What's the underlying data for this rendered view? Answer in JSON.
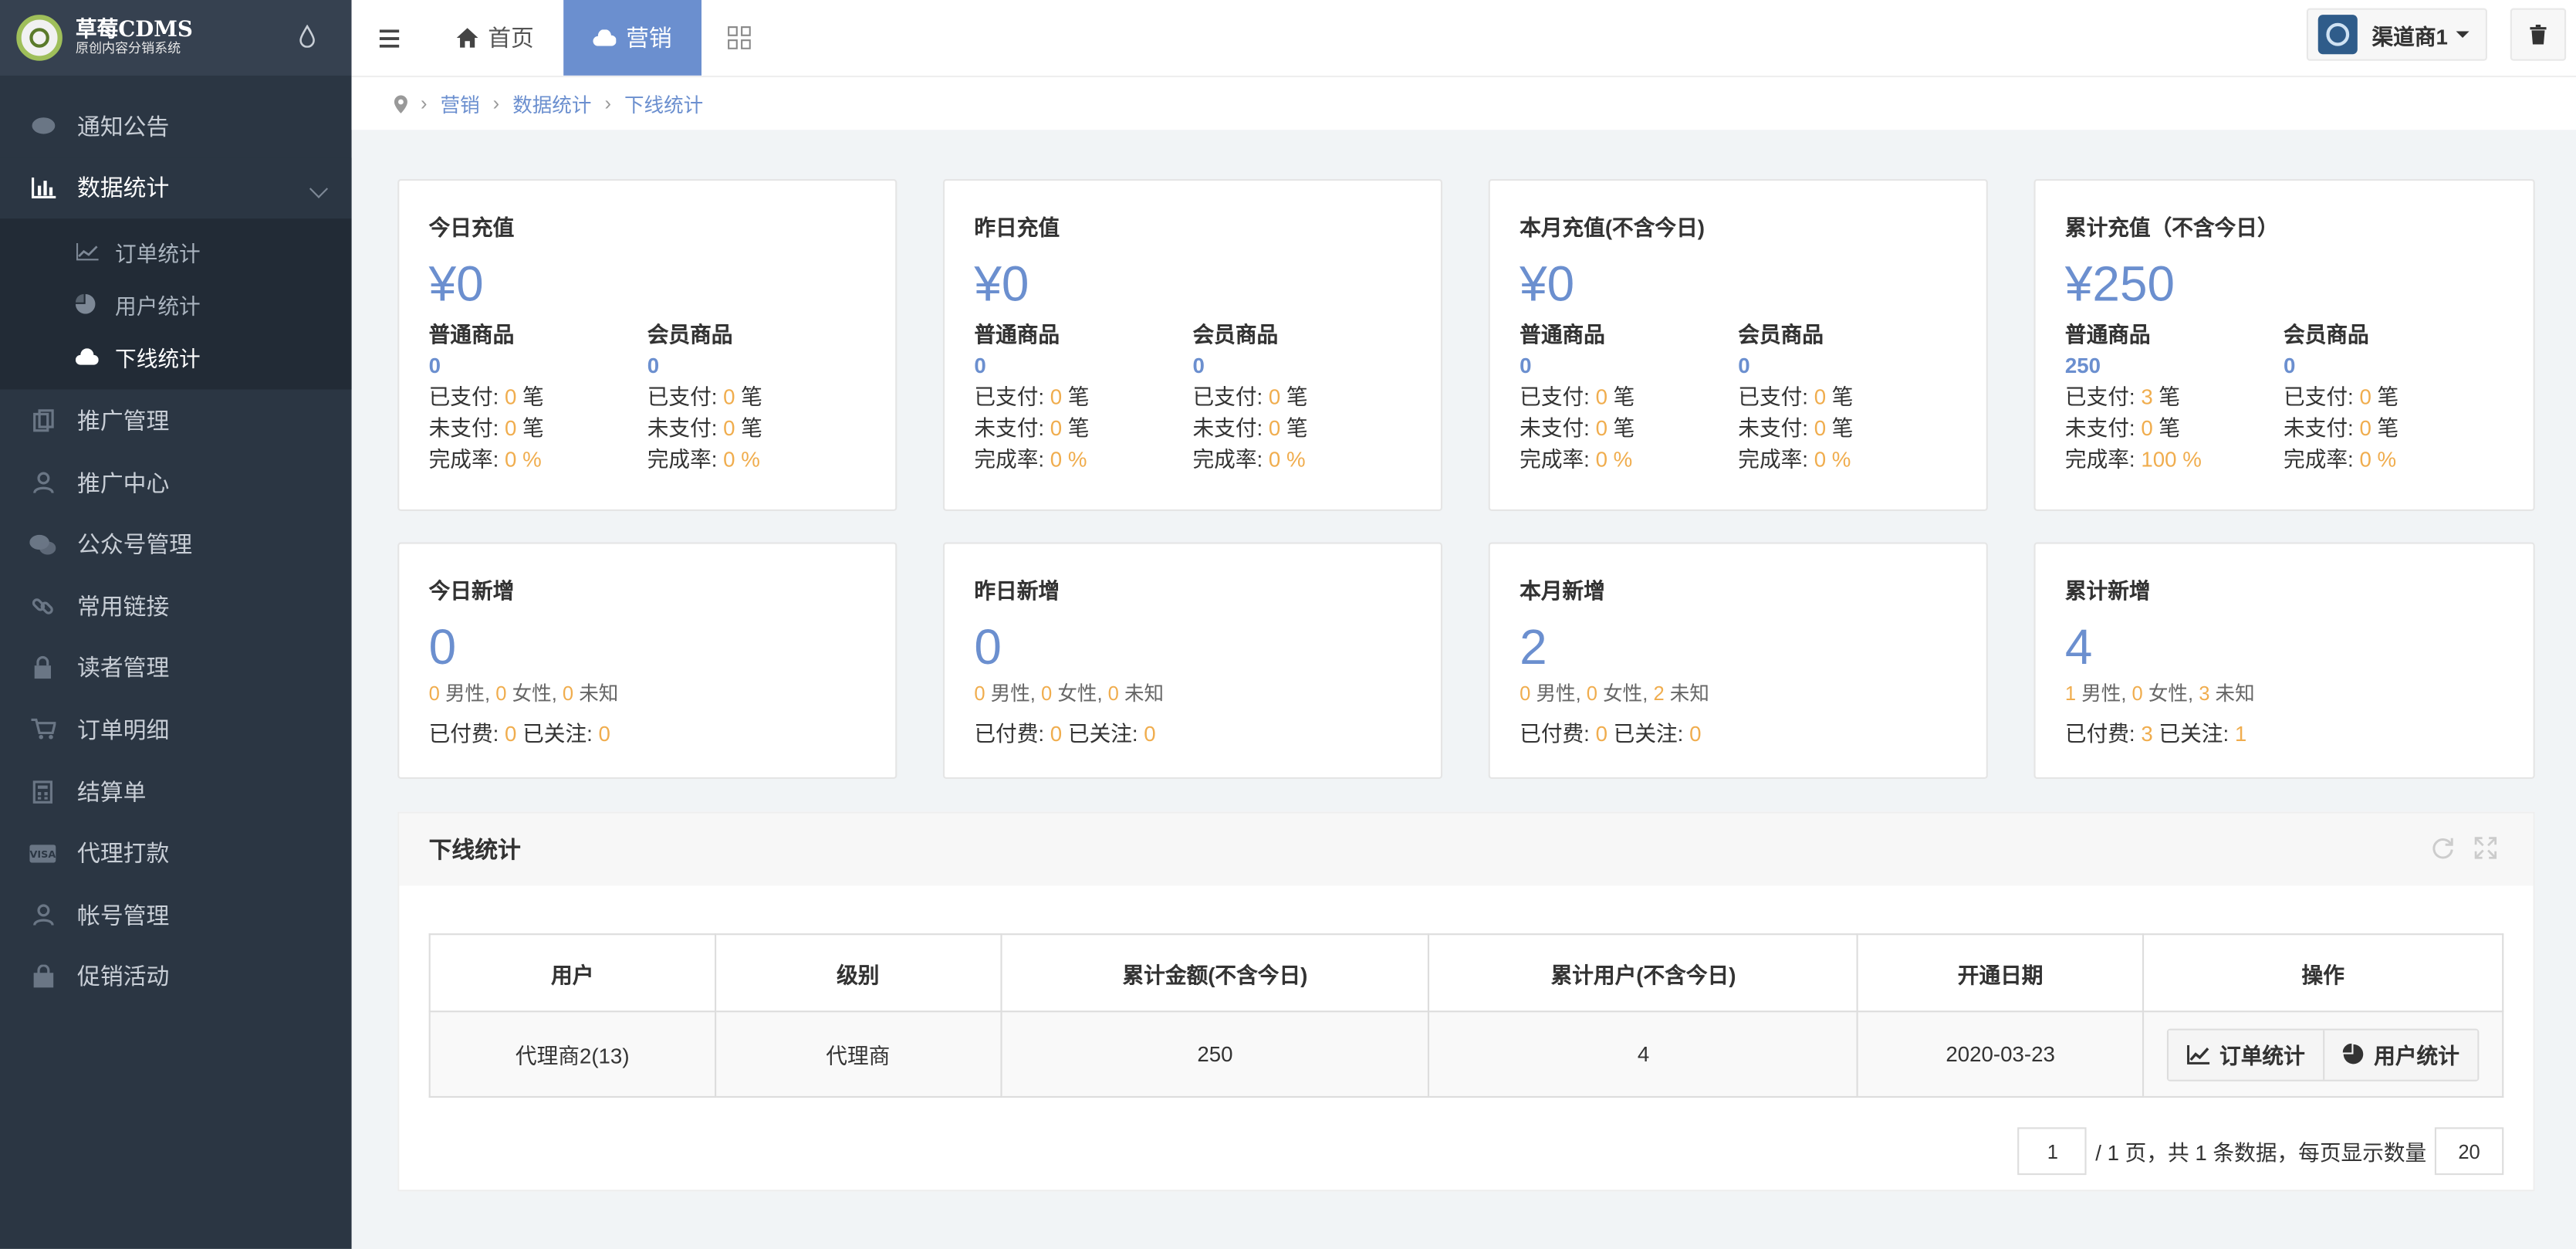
{
  "brand": {
    "title": "草莓CDMS",
    "subtitle": "原创内容分销系统"
  },
  "sidebar": {
    "items": [
      {
        "label": "通知公告",
        "icon": "comment-icon"
      },
      {
        "label": "数据统计",
        "icon": "bar-chart-icon"
      },
      {
        "label": "推广管理",
        "icon": "copy-icon"
      },
      {
        "label": "推广中心",
        "icon": "user-icon"
      },
      {
        "label": "公众号管理",
        "icon": "wechat-icon"
      },
      {
        "label": "常用链接",
        "icon": "link-icon"
      },
      {
        "label": "读者管理",
        "icon": "lock-icon"
      },
      {
        "label": "订单明细",
        "icon": "cart-icon"
      },
      {
        "label": "结算单",
        "icon": "calculator-icon"
      },
      {
        "label": "代理打款",
        "icon": "visa-icon"
      },
      {
        "label": "帐号管理",
        "icon": "user-icon"
      },
      {
        "label": "促销活动",
        "icon": "shopping-bag-icon"
      }
    ],
    "sub_items": [
      {
        "label": "订单统计",
        "icon": "line-chart-icon"
      },
      {
        "label": "用户统计",
        "icon": "pie-chart-icon"
      },
      {
        "label": "下线统计",
        "icon": "cloud-chart-icon"
      }
    ]
  },
  "topbar": {
    "tabs": [
      {
        "label": "首页",
        "icon": "home-icon"
      },
      {
        "label": "营销",
        "icon": "cloud-icon"
      }
    ],
    "user": "渠道商1"
  },
  "breadcrumb": [
    "营销",
    "数据统计",
    "下线统计"
  ],
  "recharge_cards": [
    {
      "title": "今日充值",
      "amount": "¥0",
      "normal_label": "普通商品",
      "normal_value": "0",
      "member_label": "会员商品",
      "member_value": "0",
      "normal_paid": "0",
      "normal_unpaid": "0",
      "normal_rate": "0 %",
      "member_paid": "0",
      "member_unpaid": "0",
      "member_rate": "0 %"
    },
    {
      "title": "昨日充值",
      "amount": "¥0",
      "normal_label": "普通商品",
      "normal_value": "0",
      "member_label": "会员商品",
      "member_value": "0",
      "normal_paid": "0",
      "normal_unpaid": "0",
      "normal_rate": "0 %",
      "member_paid": "0",
      "member_unpaid": "0",
      "member_rate": "0 %"
    },
    {
      "title": "本月充值(不含今日)",
      "amount": "¥0",
      "normal_label": "普通商品",
      "normal_value": "0",
      "member_label": "会员商品",
      "member_value": "0",
      "normal_paid": "0",
      "normal_unpaid": "0",
      "normal_rate": "0 %",
      "member_paid": "0",
      "member_unpaid": "0",
      "member_rate": "0 %"
    },
    {
      "title": "累计充值（不含今日）",
      "amount": "¥250",
      "normal_label": "普通商品",
      "normal_value": "250",
      "member_label": "会员商品",
      "member_value": "0",
      "normal_paid": "3",
      "normal_unpaid": "0",
      "normal_rate": "100 %",
      "member_paid": "0",
      "member_unpaid": "0",
      "member_rate": "0 %"
    }
  ],
  "labels": {
    "paid": "已支付: ",
    "unpaid": "未支付: ",
    "rate": "完成率: ",
    "unit": " 笔",
    "male": " 男性, ",
    "female": " 女性, ",
    "unknown": " 未知",
    "paid_fee": "已付费: ",
    "followed": " 已关注: "
  },
  "new_cards": [
    {
      "title": "今日新增",
      "count": "0",
      "male": "0",
      "female": "0",
      "unknown": "0",
      "paid": "0",
      "followed": "0"
    },
    {
      "title": "昨日新增",
      "count": "0",
      "male": "0",
      "female": "0",
      "unknown": "0",
      "paid": "0",
      "followed": "0"
    },
    {
      "title": "本月新增",
      "count": "2",
      "male": "0",
      "female": "0",
      "unknown": "2",
      "paid": "0",
      "followed": "0"
    },
    {
      "title": "累计新增",
      "count": "4",
      "male": "1",
      "female": "0",
      "unknown": "3",
      "paid": "3",
      "followed": "1"
    }
  ],
  "panel": {
    "title": "下线统计",
    "columns": [
      "用户",
      "级别",
      "累计金额(不含今日)",
      "累计用户(不含今日)",
      "开通日期",
      "操作"
    ],
    "rows": [
      {
        "user": "代理商2(13)",
        "level": "代理商",
        "amount": "250",
        "users": "4",
        "date": "2020-03-23"
      }
    ],
    "action_order": "订单统计",
    "action_user": "用户统计"
  },
  "pager": {
    "page": "1",
    "mid_text": "/ 1 页，共 1 条数据，每页显示数量",
    "page_size": "20"
  }
}
